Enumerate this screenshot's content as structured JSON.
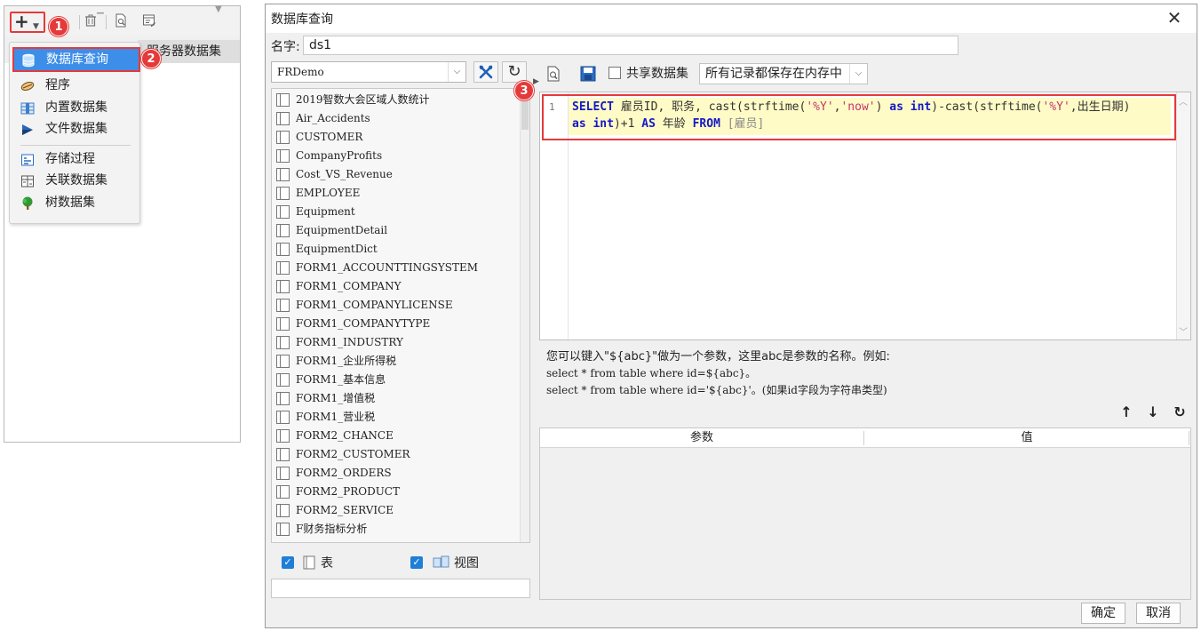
{
  "left_panel": {
    "add_glyph": "+",
    "server_dataset_header": "服务器数据集",
    "menu": [
      {
        "label": "数据库查询",
        "icon": "database-icon"
      },
      {
        "label": "程序",
        "icon": "program-icon"
      },
      {
        "label": "内置数据集",
        "icon": "builtin-dataset-icon"
      },
      {
        "label": "文件数据集",
        "icon": "file-dataset-icon"
      },
      {
        "label": "存储过程",
        "icon": "stored-procedure-icon"
      },
      {
        "label": "关联数据集",
        "icon": "join-dataset-icon"
      },
      {
        "label": "树数据集",
        "icon": "tree-dataset-icon"
      }
    ],
    "badges": [
      "1",
      "2"
    ]
  },
  "dialog": {
    "title": "数据库查询",
    "close_glyph": "✕",
    "name_label": "名字:",
    "name_value": "ds1",
    "connection": "FRDemo",
    "tables": [
      "2019智数大会区域人数统计",
      "Air_Accidents",
      "CUSTOMER",
      "CompanyProfits",
      "Cost_VS_Revenue",
      "EMPLOYEE",
      "Equipment",
      "EquipmentDetail",
      "EquipmentDict",
      "FORM1_ACCOUNTTINGSYSTEM",
      "FORM1_COMPANY",
      "FORM1_COMPANYLICENSE",
      "FORM1_COMPANYTYPE",
      "FORM1_INDUSTRY",
      "FORM1_企业所得税",
      "FORM1_基本信息",
      "FORM1_增值税",
      "FORM1_营业税",
      "FORM2_CHANCE",
      "FORM2_CUSTOMER",
      "FORM2_ORDERS",
      "FORM2_PRODUCT",
      "FORM2_SERVICE",
      "F财务指标分析"
    ],
    "filter": {
      "table_label": "表",
      "view_label": "视图"
    },
    "shared_dataset_label": "共享数据集",
    "storage_mode": "所有记录都保存在内存中",
    "badge3": "3",
    "sql": {
      "line_number": "1",
      "line1_tokens": [
        {
          "t": "SELECT",
          "c": "kw"
        },
        {
          "t": " 雇员ID, 职务, cast(strftime(",
          "c": "pl"
        },
        {
          "t": "'%Y'",
          "c": "str"
        },
        {
          "t": ",",
          "c": "pl"
        },
        {
          "t": "'now'",
          "c": "str"
        },
        {
          "t": ") ",
          "c": "pl"
        },
        {
          "t": "as int",
          "c": "kw"
        },
        {
          "t": ")-cast(strftime(",
          "c": "pl"
        },
        {
          "t": "'%Y'",
          "c": "str"
        },
        {
          "t": ",出生日期)",
          "c": "pl"
        }
      ],
      "line2_tokens": [
        {
          "t": "as int",
          "c": "kw"
        },
        {
          "t": ")+1 ",
          "c": "pl"
        },
        {
          "t": "AS",
          "c": "kw"
        },
        {
          "t": " 年龄 ",
          "c": "pl"
        },
        {
          "t": "FROM",
          "c": "kw"
        },
        {
          "t": " [雇员]",
          "c": "tblref"
        }
      ]
    },
    "hint": {
      "line1": "您可以键入\"${abc}\"做为一个参数，这里abc是参数的名称。例如:",
      "line2": "select * from table where id=${abc}。",
      "line3": "select * from table where id='${abc}'。(如果id字段为字符串类型)"
    },
    "param_actions": [
      "↑",
      "↓",
      "↻"
    ],
    "param_columns": [
      "参数",
      "值"
    ],
    "ok_label": "确定",
    "cancel_label": "取消"
  }
}
